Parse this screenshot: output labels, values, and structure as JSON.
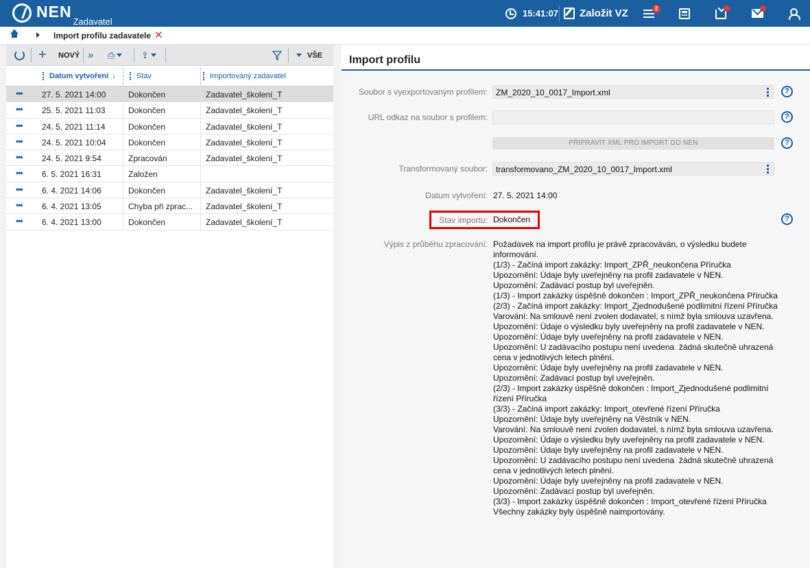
{
  "app": {
    "logo": "NEN",
    "subtitle": "Zadavatel"
  },
  "topbar": {
    "time": "15:41:07",
    "new_contract": "Založit VZ",
    "menu_badge": "2",
    "icons": [
      "clock-icon",
      "edit-icon",
      "menu-icon",
      "calculator-icon",
      "inbox-icon",
      "mail-icon",
      "user-icon"
    ],
    "colors": {
      "bar": "#1a5fa0",
      "badge": "#e53935"
    }
  },
  "breadcrumb": {
    "tab": "Import profilu zadavatele"
  },
  "toolbar": {
    "new_label": "NOVÝ",
    "all_label": "VŠE"
  },
  "grid": {
    "columns": [
      "Datum vytvoření",
      "Stav",
      "Importovaný zadavatel"
    ],
    "rows": [
      {
        "date": "27. 5. 2021 14:00",
        "state": "Dokončen",
        "importer": "Zadavatel_školení_T"
      },
      {
        "date": "25. 5. 2021 11:03",
        "state": "Dokončen",
        "importer": "Zadavatel_školení_T"
      },
      {
        "date": "24. 5. 2021 11:14",
        "state": "Dokončen",
        "importer": "Zadavatel_školení_T"
      },
      {
        "date": "24. 5. 2021 10:04",
        "state": "Dokončen",
        "importer": "Zadavatel_školení_T"
      },
      {
        "date": "24. 5. 2021 9:54",
        "state": "Zpracován",
        "importer": "Zadavatel_školení_T"
      },
      {
        "date": "6. 5. 2021 16:31",
        "state": "Založen",
        "importer": ""
      },
      {
        "date": "6. 4. 2021 14:06",
        "state": "Dokončen",
        "importer": "Zadavatel_školení_T"
      },
      {
        "date": "6. 4. 2021 13:05",
        "state": "Chyba při zprac...",
        "importer": "Zadavatel_školení_T"
      },
      {
        "date": "6. 4. 2021 13:00",
        "state": "Dokončen",
        "importer": "Zadavatel_školení_T"
      }
    ]
  },
  "detail": {
    "title": "Import profilu",
    "file_label": "Soubor s vyexportovaným profilem:",
    "file_value": "ZM_2020_10_0017_Import.xml",
    "url_label": "URL odkaz na soubor s profilem:",
    "url_value": "",
    "prepare_button": "PŘIPRAVIT XML PRO IMPORT DO NEN",
    "transformed_label": "Transformovaný soubor:",
    "transformed_value": "transformovano_ZM_2020_10_0017_Import.xml",
    "created_label": "Datum vytvoření:",
    "created_value": "27. 5. 2021 14:00",
    "status_label": "Stav importu:",
    "status_value": "Dokončen",
    "log_label": "Výpis z průběhu zpracování:",
    "log_lines": [
      "Požadavek na import profilu je právě zpracováván, o výsledku budete informování.",
      "(1/3) - Začíná import zakázky: Import_ZPŘ_neukončena Příručka",
      "Upozornění: Údaje byly uveřejněny na profil zadavatele v NEN.",
      "Upozornění: Zadávací postup byl uveřejněn.",
      "(1/3) - Import zakázky úspěšně dokončen : Import_ZPŘ_neukončena Příručka",
      "(2/3) - Začíná import zakázky: Import_Zjednodušené podlimitní řízení Příručka",
      "Varování: Na smlouvě není zvolen dodavatel, s nímž byla smlouva uzavřena.",
      "Upozornění: Údaje o výsledku byly uveřejněny na profil zadavatele v NEN.",
      "Upozornění: Údaje byly uveřejněny na profil zadavatele v NEN.",
      "Upozornění: U zadávacího postupu není uvedena  žádná skutečně uhrazená cena v jednotlivých letech plnění.",
      "Upozornění: Údaje byly uveřejněny na profil zadavatele v NEN.",
      "Upozornění: Zadávací postup byl uveřejněn.",
      "(2/3) - Import zakázky úspěšně dokončen : Import_Zjednodušené podlimitní řízení Příručka",
      "(3/3) - Začíná import zakázky: Import_otevřené řízení Příručka",
      "Upozornění: Údaje byly uveřejněny na Věstník v NEN.",
      "Varování: Na smlouvě není zvolen dodavatel, s nímž byla smlouva uzavřena.",
      "Upozornění: Údaje o výsledku byly uveřejněny na profil zadavatele v NEN.",
      "Upozornění: Údaje byly uveřejněny na profil zadavatele v NEN.",
      "Upozornění: U zadávacího postupu není uvedena  žádná skutečně uhrazená cena v jednotlivých letech plnění.",
      "Upozornění: Údaje byly uveřejněny na profil zadavatele v NEN.",
      "Upozornění: Zadávací postup byl uveřejněn.",
      "(3/3) - Import zakázky úspěšně dokončen : Import_otevřené řízení Příručka",
      "Všechny zakázky byly úspěšně naimportovány."
    ]
  }
}
